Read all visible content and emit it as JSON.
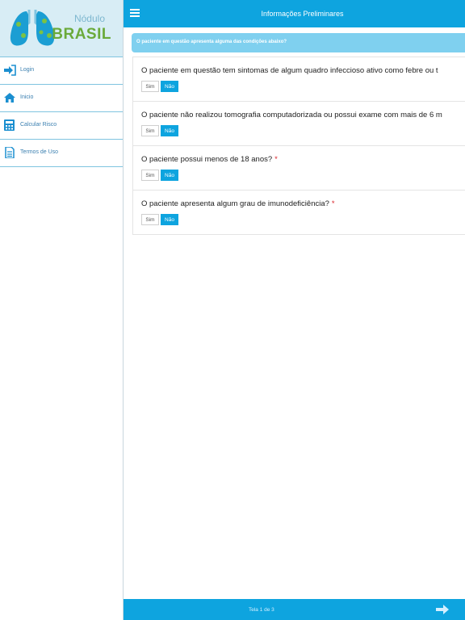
{
  "sidebar": {
    "logo": {
      "top": "Nódulo",
      "bottom": "BRASIL"
    },
    "items": [
      {
        "label": "Login",
        "icon": "login-icon"
      },
      {
        "label": "Inicio",
        "icon": "home-icon"
      },
      {
        "label": "Calcular Risco",
        "icon": "calculator-icon"
      },
      {
        "label": "Termos de Uso",
        "icon": "document-icon"
      }
    ]
  },
  "header": {
    "title": "Informações Preliminares"
  },
  "banner": {
    "text": "O paciente em questão apresenta alguma das condições abaixo?"
  },
  "questions": [
    {
      "text": "O paciente em questão tem sintomas de algum quadro infeccioso ativo como febre ou t",
      "required": "",
      "yes": "Sim",
      "no": "Não"
    },
    {
      "text": "O paciente não realizou tomografia computadorizada ou possui exame com mais de 6 m",
      "required": "",
      "yes": "Sim",
      "no": "Não"
    },
    {
      "text": "O paciente possui menos de 18 anos?",
      "required": "*",
      "yes": "Sim",
      "no": "Não"
    },
    {
      "text": "O paciente apresenta algum grau de imunodeficiência?",
      "required": "*",
      "yes": "Sim",
      "no": "Não"
    }
  ],
  "footer": {
    "page": "Tela 1 de 3"
  },
  "colors": {
    "primary": "#0ea4df",
    "banner": "#7fd0ef",
    "logo_bg": "#d8edf5",
    "brand_green": "#6aaa3a",
    "required": "#d9252b"
  }
}
